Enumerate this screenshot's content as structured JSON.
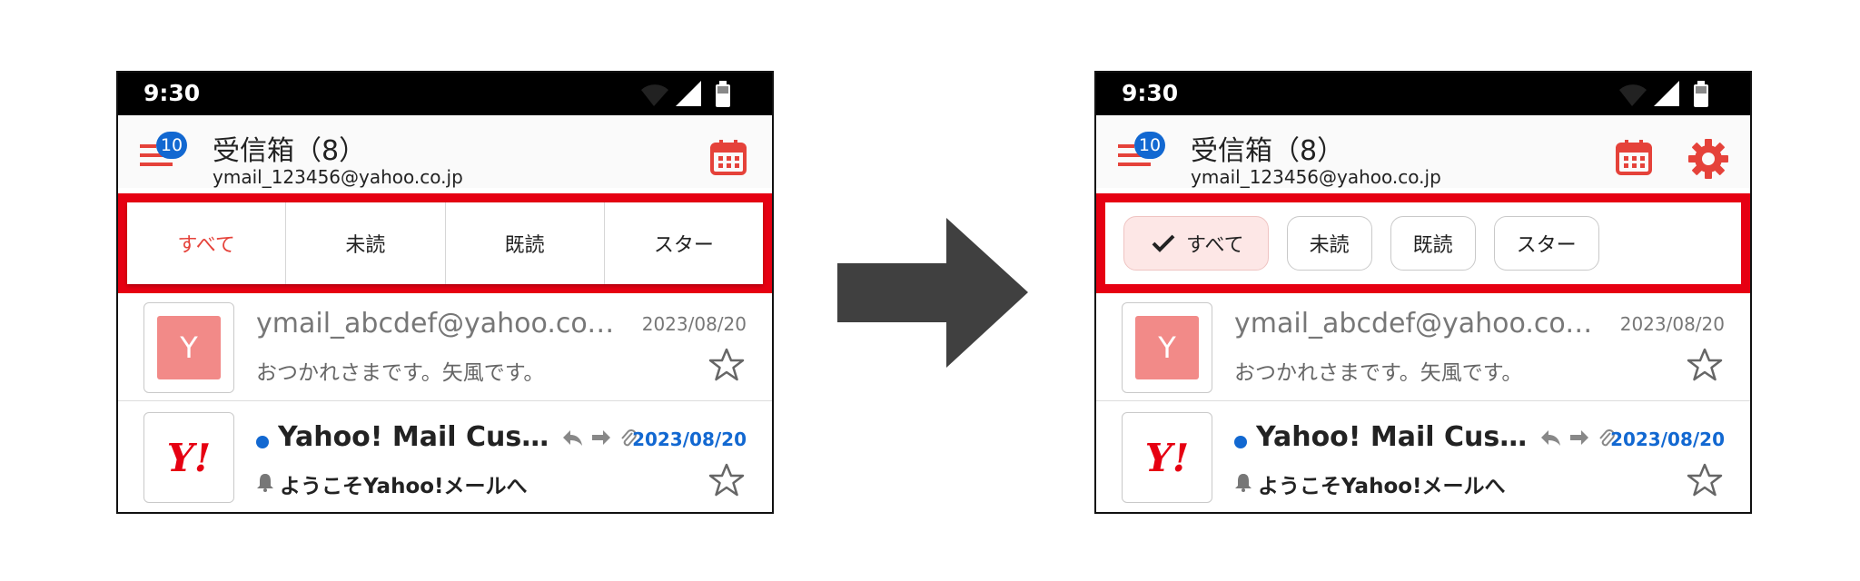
{
  "status_bar": {
    "time": "9:30"
  },
  "header": {
    "menu_badge": "10",
    "title": "受信箱（8）",
    "account": "ymail_123456@yahoo.co.jp"
  },
  "filters": {
    "all": "すべて",
    "unread": "未読",
    "read": "既読",
    "starred": "スター",
    "selected": "すべて"
  },
  "mails": [
    {
      "avatar_letter": "Y",
      "sender": "ymail_abcdef@yahoo.co.jp",
      "date": "2023/08/20",
      "snippet": "おつかれさまです。矢風です。",
      "unread": false
    },
    {
      "logo_text": "Y!",
      "sender": "Yahoo! Mail Customer Support",
      "date": "2023/08/20",
      "snippet": "ようこそYahoo!メールへ",
      "unread": true
    }
  ],
  "colors": {
    "accent_red": "#e60012",
    "selected_chip_bg": "#fde7e6",
    "unread_blue": "#1268d1",
    "arrow": "#404040"
  },
  "icons": {
    "menu": "menu-icon",
    "calendar": "calendar-icon",
    "settings": "gear-icon",
    "star": "star-outline-icon",
    "reply": "reply-icon",
    "forward": "forward-icon",
    "attachment": "paperclip-icon",
    "bell": "bell-icon",
    "check": "check-icon"
  }
}
